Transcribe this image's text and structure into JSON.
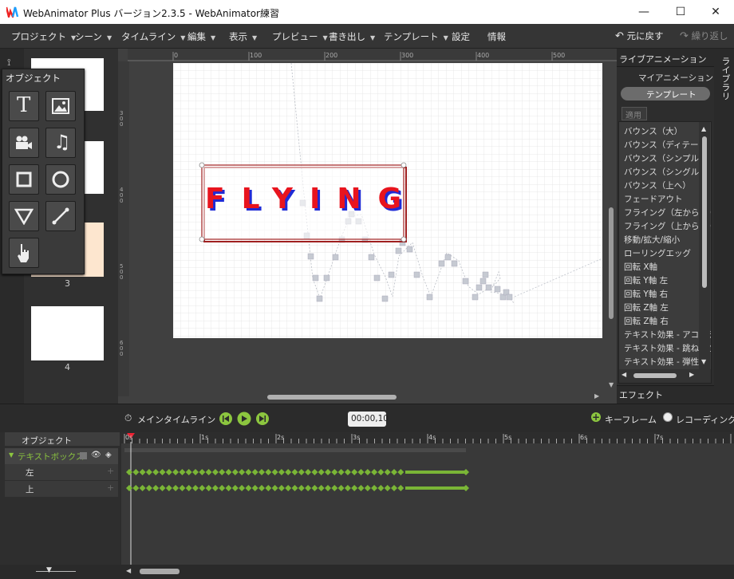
{
  "window": {
    "title": "WebAnimator Plus バージョン2.3.5 - WebAnimator練習",
    "minimize": "—",
    "maximize": "☐",
    "close": "✕"
  },
  "menu": [
    {
      "label": "プロジェクト"
    },
    {
      "label": "シーン"
    },
    {
      "label": "タイムライン"
    },
    {
      "label": "編集"
    },
    {
      "label": "表示"
    },
    {
      "label": "プレビュー"
    },
    {
      "label": "書き出し"
    },
    {
      "label": "テンプレート"
    },
    {
      "label": "設定"
    },
    {
      "label": "情報"
    }
  ],
  "toolbar": {
    "undo": "元に戻す",
    "redo": "繰り返し"
  },
  "objects_panel": {
    "title": "オブジェクト"
  },
  "scenes": {
    "selected_label": "3",
    "last_label": "4"
  },
  "ruler": {
    "h_ticks": [
      "0",
      "100",
      "200",
      "300",
      "400",
      "500"
    ],
    "v_ticks": [
      "300",
      "400",
      "500",
      "600"
    ]
  },
  "stage": {
    "text": "FLYING"
  },
  "live_animation": {
    "title": "ライブアニメーション",
    "my_animation": "マイアニメーション",
    "template": "テンプレート",
    "apply": "適用",
    "items": [
      "バウンス（大）",
      "バウンス（ディテール）",
      "バウンス（シンプル）",
      "バウンス（シングル）",
      "バウンス（上へ）",
      "フェードアウト",
      "フライング（左から右）",
      "フライング（上から下）",
      "移動/拡大/縮小",
      "ローリングエッグ",
      "回転 X軸",
      "回転 Y軸 左",
      "回転 Y軸 右",
      "回転 Z軸 左",
      "回転 Z軸 右",
      "テキスト効果 - アコーディ",
      "テキスト効果 - 跳ね返り",
      "テキスト効果 - 弾性"
    ],
    "effects": "エフェクト",
    "library_tab": "ライブラリ"
  },
  "timeline": {
    "main_timeline": "メインタイムライン",
    "time": "00:00,10",
    "keyframe": "キーフレーム",
    "recording": "レコーディング",
    "object_header": "オブジェクト",
    "rows": [
      {
        "label": "テキストボックス"
      },
      {
        "label": "左"
      },
      {
        "label": "上"
      }
    ],
    "seconds": [
      "0s",
      "1s",
      "2s",
      "3s",
      "4s",
      "5s",
      "6s",
      "7s"
    ]
  },
  "colors": {
    "accent_green": "#7ab536",
    "text_red": "#e8141e",
    "text_blue": "#1f2bd6",
    "box_red": "#a02020"
  }
}
